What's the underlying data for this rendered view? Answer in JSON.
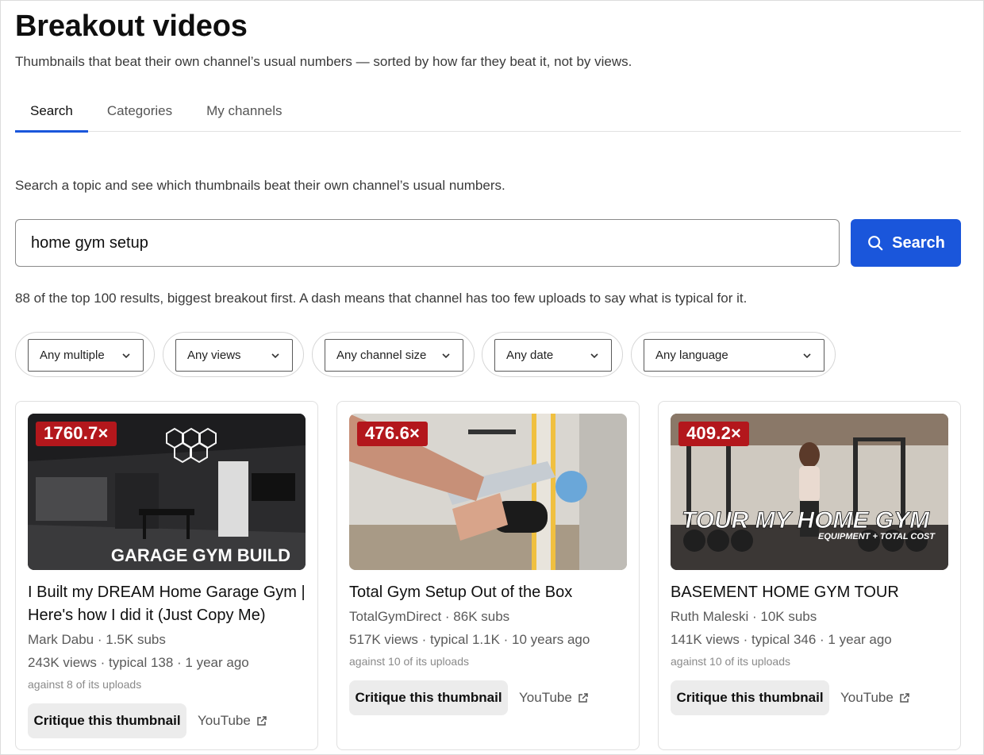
{
  "header": {
    "title": "Breakout videos",
    "subtitle": "Thumbnails that beat their own channel’s usual numbers — sorted by how far they beat it, not by views."
  },
  "tabs": [
    {
      "label": "Search",
      "active": true
    },
    {
      "label": "Categories",
      "active": false
    },
    {
      "label": "My channels",
      "active": false
    }
  ],
  "search": {
    "intro": "Search a topic and see which thumbnails beat their own channel’s usual numbers.",
    "query": "home gym setup",
    "button_label": "Search",
    "results_summary": "88 of the top 100 results, biggest breakout first. A dash means that channel has too few uploads to say what is typical for it."
  },
  "filters": [
    {
      "selected": "Any multiple"
    },
    {
      "selected": "Any views"
    },
    {
      "selected": "Any channel size"
    },
    {
      "selected": "Any date"
    },
    {
      "selected": "Any language"
    }
  ],
  "colors": {
    "accent": "#1a56db",
    "badge": "#b3171c"
  },
  "cards": [
    {
      "multiple": "1760.7×",
      "thumbnail_text": "GARAGE GYM BUILD",
      "title": "I Built my DREAM Home Garage Gym | Here's how I did it (Just Copy Me)",
      "channel": "Mark Dabu · 1.5K subs",
      "stats": "243K views · typical 138 · 1 year ago",
      "baseline": "against 8 of its uploads",
      "critique_label": "Critique this thumbnail",
      "link_label": "YouTube"
    },
    {
      "multiple": "476.6×",
      "thumbnail_text": "",
      "title": "Total Gym Setup Out of the Box",
      "channel": "TotalGymDirect · 86K subs",
      "stats": "517K views · typical 1.1K · 10 years ago",
      "baseline": "against 10 of its uploads",
      "critique_label": "Critique this thumbnail",
      "link_label": "YouTube"
    },
    {
      "multiple": "409.2×",
      "thumbnail_text": "TOUR MY HOME GYM",
      "thumbnail_subtext": "EQUIPMENT + TOTAL COST",
      "title": "BASEMENT HOME GYM TOUR",
      "channel": "Ruth Maleski · 10K subs",
      "stats": "141K views · typical 346 · 1 year ago",
      "baseline": "against 10 of its uploads",
      "critique_label": "Critique this thumbnail",
      "link_label": "YouTube"
    }
  ]
}
